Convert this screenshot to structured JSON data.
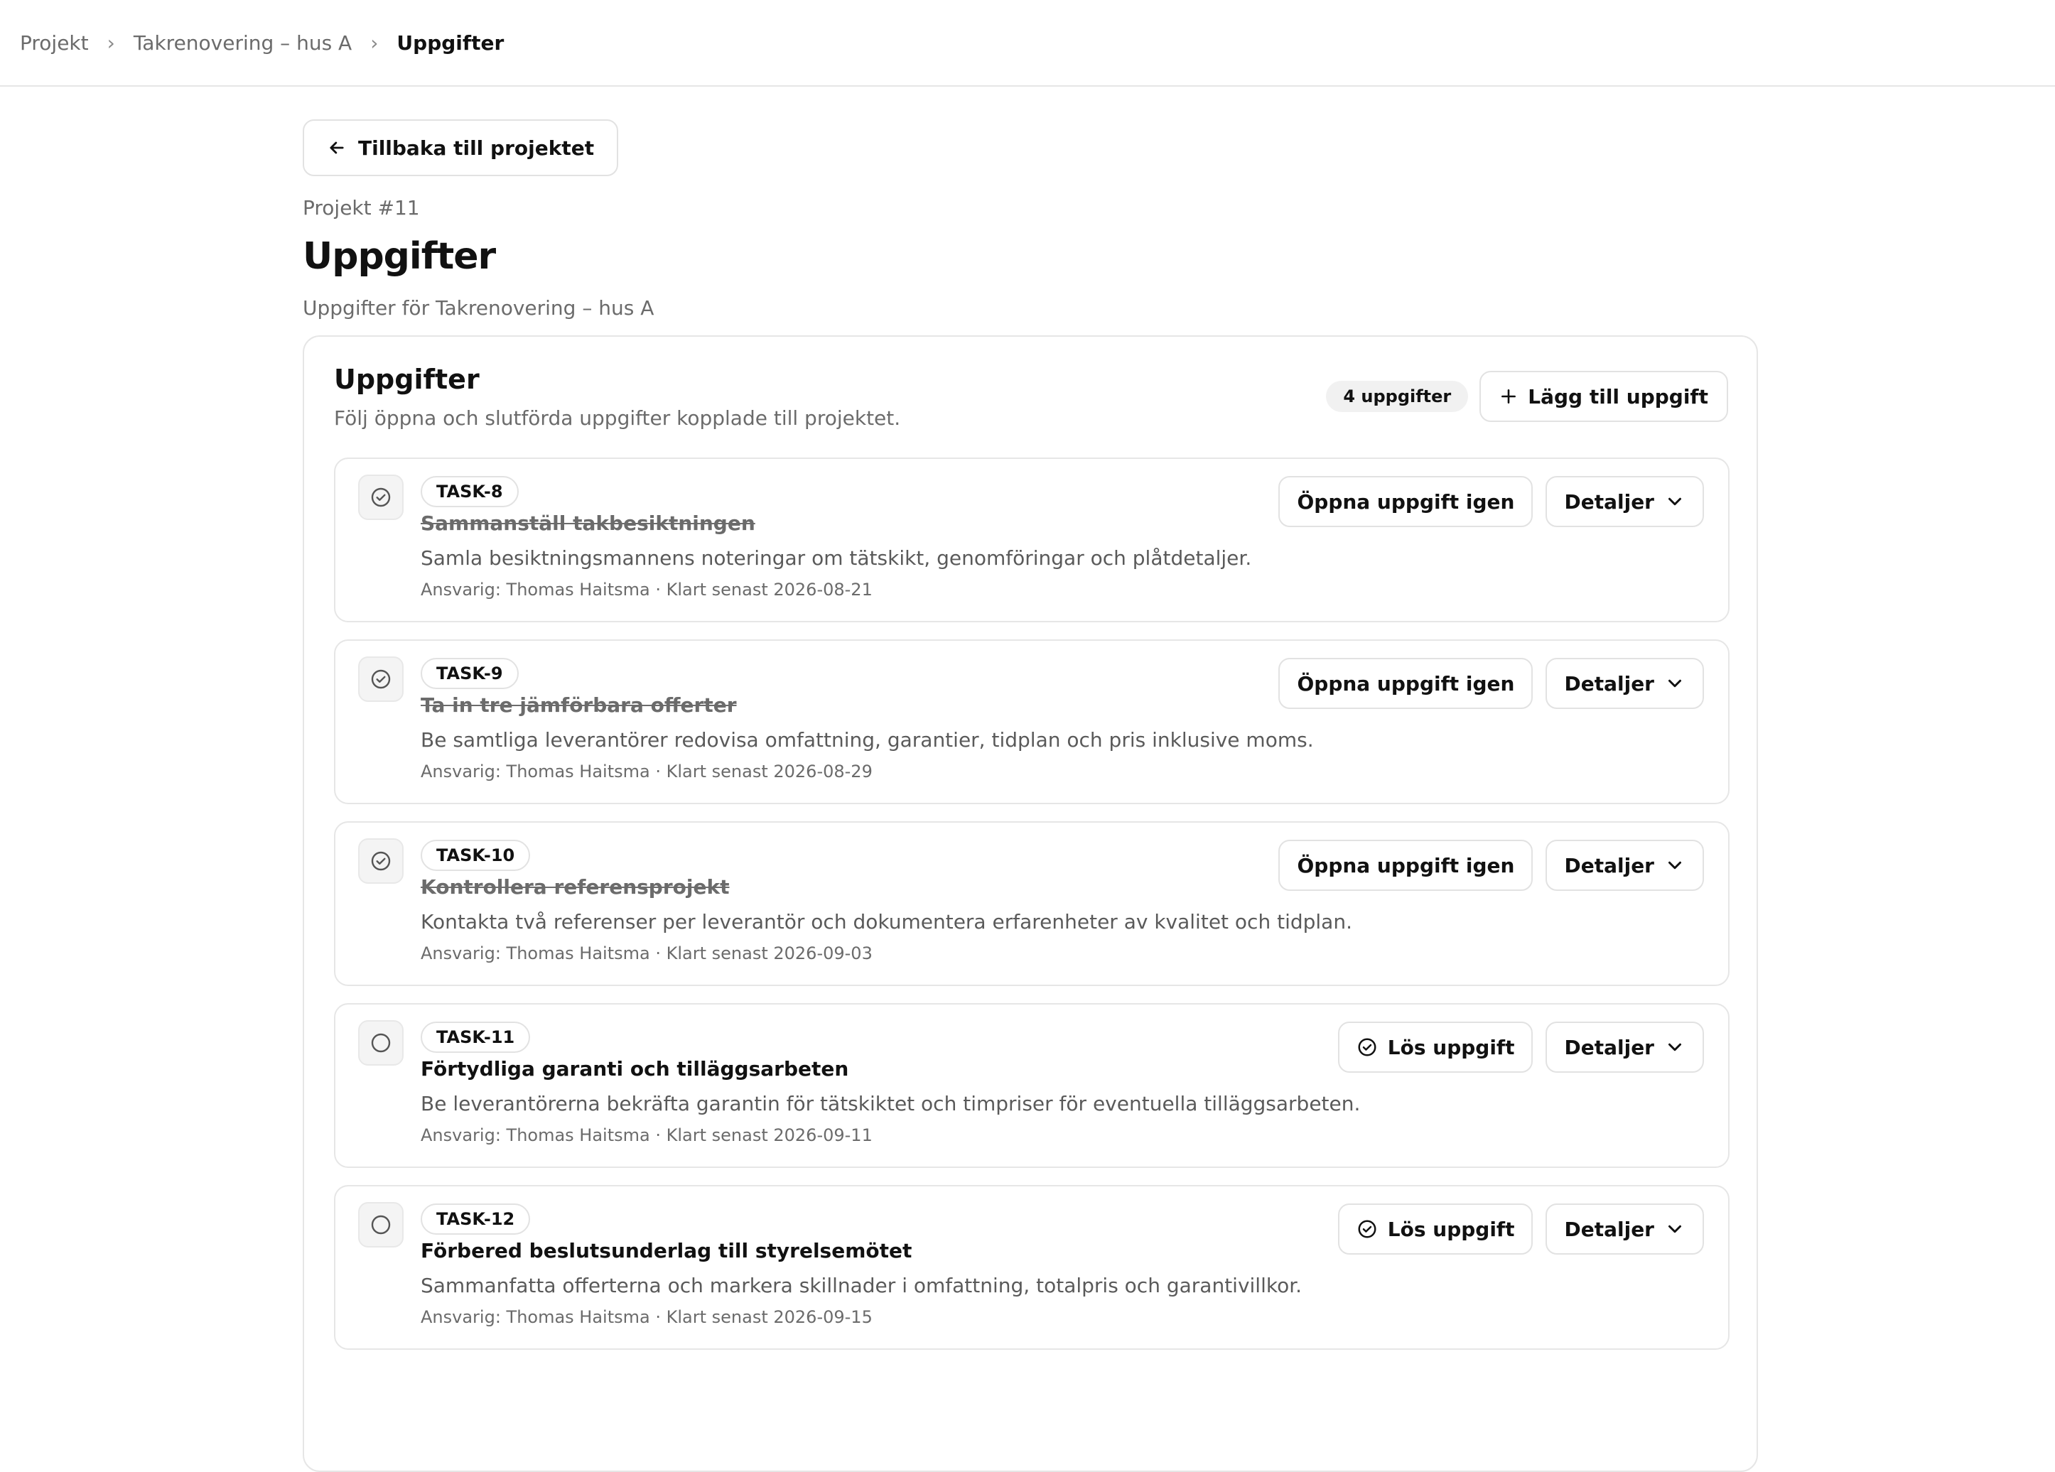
{
  "breadcrumb": [
    "Projekt",
    "Takrenovering – hus A",
    "Uppgifter"
  ],
  "back_label": "Tillbaka till projektet",
  "project_id": "Projekt #11",
  "page_title": "Uppgifter",
  "page_subtitle": "Uppgifter för Takrenovering – hus A",
  "card": {
    "title": "Uppgifter",
    "subtitle": "Följ öppna och slutförda uppgifter kopplade till projektet.",
    "count": "4 uppgifter",
    "add_label": "Lägg till uppgift"
  },
  "details_label": "Detaljer",
  "reopen_label": "Öppna uppgift igen",
  "resolve_label": "Lös uppgift",
  "tasks": [
    {
      "id": "TASK-8",
      "title": "Sammanställ takbesiktningen",
      "done": true,
      "description": "Samla besiktningsmannens noteringar om tätskikt, genomföringar och plåtdetaljer.",
      "meta": "Ansvarig: Thomas Haitsma · Klart senast 2026-08-21"
    },
    {
      "id": "TASK-9",
      "title": "Ta in tre jämförbara offerter",
      "done": true,
      "description": "Be samtliga leverantörer redovisa omfattning, garantier, tidplan och pris inklusive moms.",
      "meta": "Ansvarig: Thomas Haitsma · Klart senast 2026-08-29"
    },
    {
      "id": "TASK-10",
      "title": "Kontrollera referensprojekt",
      "done": true,
      "description": "Kontakta två referenser per leverantör och dokumentera erfarenheter av kvalitet och tidplan.",
      "meta": "Ansvarig: Thomas Haitsma · Klart senast 2026-09-03"
    },
    {
      "id": "TASK-11",
      "title": "Förtydliga garanti och tilläggsarbeten",
      "done": false,
      "description": "Be leverantörerna bekräfta garantin för tätskiktet och timpriser för eventuella tilläggsarbeten.",
      "meta": "Ansvarig: Thomas Haitsma · Klart senast 2026-09-11"
    },
    {
      "id": "TASK-12",
      "title": "Förbered beslutsunderlag till styrelsemötet",
      "done": false,
      "description": "Sammanfatta offerterna och markera skillnader i omfattning, totalpris och garantivillkor.",
      "meta": "Ansvarig: Thomas Haitsma · Klart senast 2026-09-15"
    }
  ]
}
